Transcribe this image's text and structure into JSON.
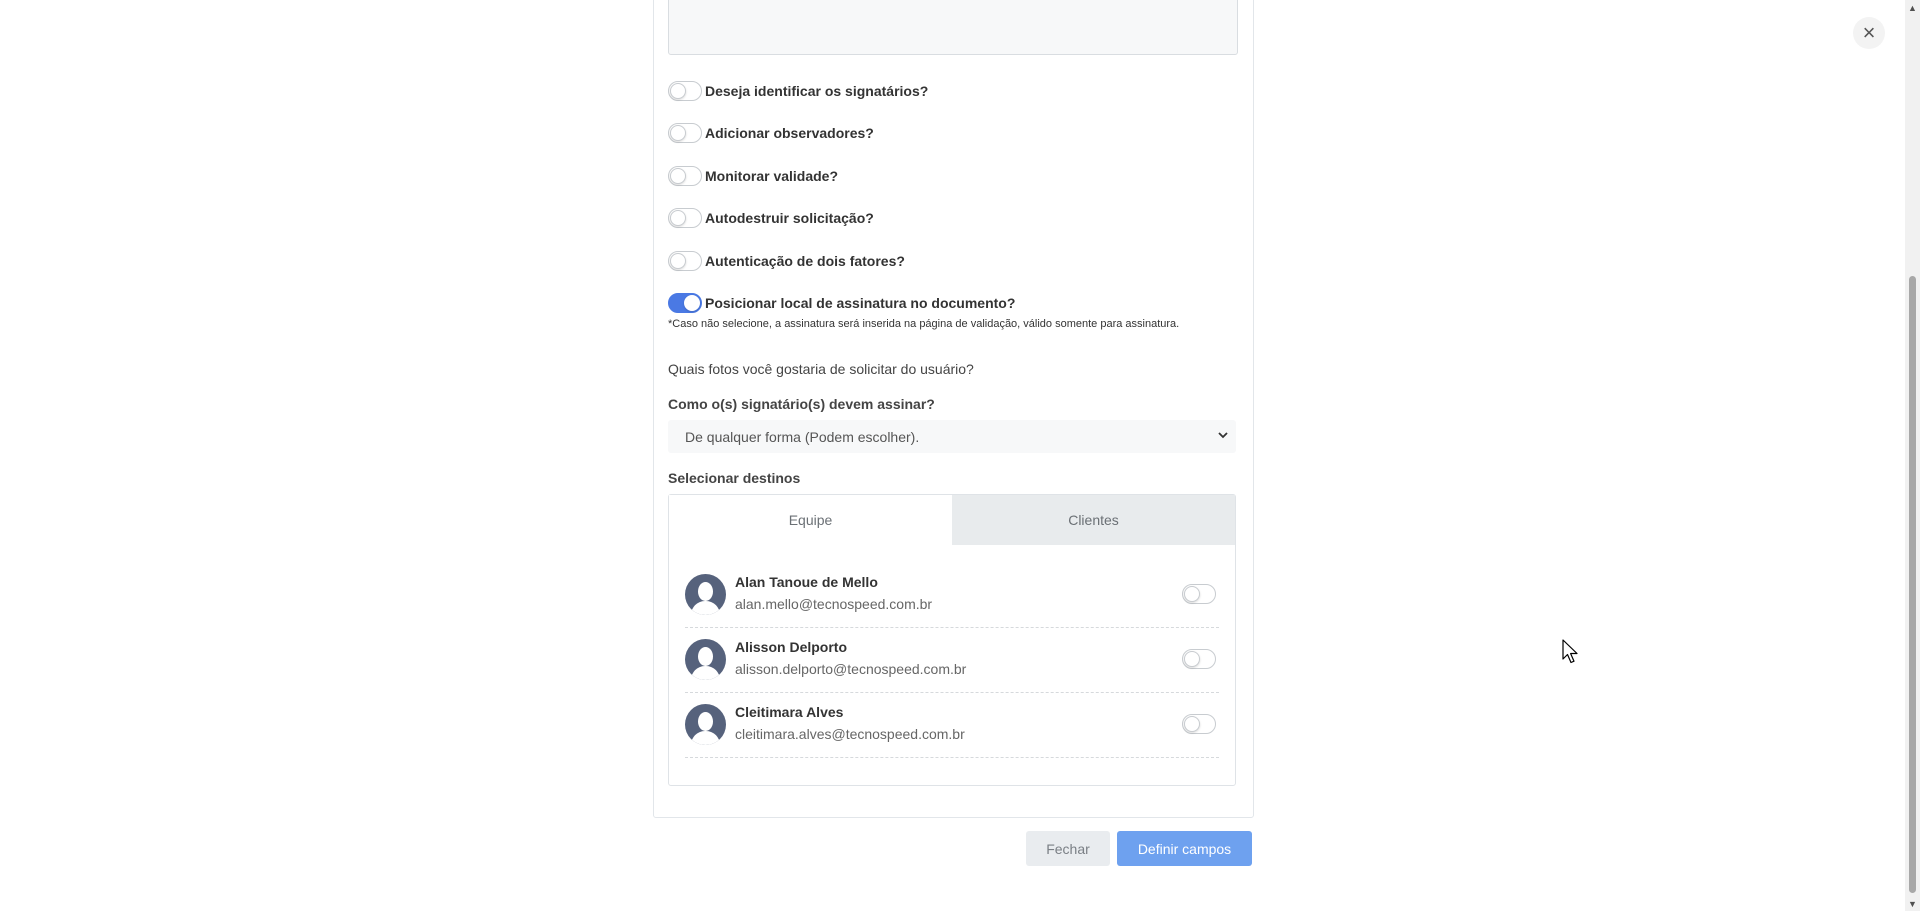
{
  "toggles": [
    {
      "label": "Deseja identificar os signatários?",
      "on": false
    },
    {
      "label": "Adicionar observadores?",
      "on": false
    },
    {
      "label": "Monitorar validade?",
      "on": false
    },
    {
      "label": "Autodestruir solicitação?",
      "on": false
    },
    {
      "label": "Autenticação de dois fatores?",
      "on": false
    },
    {
      "label": "Posicionar local de assinatura no documento?",
      "on": true
    }
  ],
  "signature_note": "*Caso não selecione, a assinatura será inserida na página de validação, válido somente para assinatura.",
  "photos_question": "Quais fotos você gostaria de solicitar do usuário?",
  "sign_method": {
    "label": "Como o(s) signatário(s) devem assinar?",
    "selected": "De qualquer forma (Podem escolher)."
  },
  "destinations": {
    "label": "Selecionar destinos",
    "tabs": [
      {
        "label": "Equipe",
        "active": true
      },
      {
        "label": "Clientes",
        "active": false
      }
    ],
    "members": [
      {
        "name": "Alan Tanoue de Mello",
        "email": "alan.mello@tecnospeed.com.br",
        "selected": false
      },
      {
        "name": "Alisson Delporto",
        "email": "alisson.delporto@tecnospeed.com.br",
        "selected": false
      },
      {
        "name": "Cleitimara Alves",
        "email": "cleitimara.alves@tecnospeed.com.br",
        "selected": false
      }
    ]
  },
  "footer": {
    "close_label": "Fechar",
    "define_label": "Definir campos"
  },
  "icons": {
    "close": "close-icon",
    "select_chevron": "chevron-down-icon",
    "avatar": "user-avatar-icon"
  },
  "colors": {
    "accent": "#4a79e4",
    "primary_button": "#6ea1ef",
    "avatar_bg": "#56627c"
  }
}
